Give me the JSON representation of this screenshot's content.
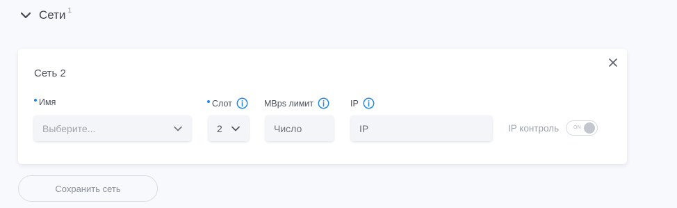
{
  "section": {
    "title": "Сети",
    "count": "1"
  },
  "card": {
    "title": "Сеть 2",
    "fields": {
      "name": {
        "label": "Имя",
        "placeholder": "Выберите..."
      },
      "slot": {
        "label": "Слот",
        "value": "2"
      },
      "mbps": {
        "label": "MBps лимит",
        "placeholder": "Число"
      },
      "ip": {
        "label": "IP",
        "placeholder": "IP"
      }
    },
    "ip_control": {
      "label": "IP контроль",
      "toggle_text": "ON"
    }
  },
  "actions": {
    "save_label": "Сохранить сеть"
  },
  "colors": {
    "accent": "#1e88e5",
    "background": "#f8f9fc",
    "card": "#ffffff"
  },
  "icons": [
    "chevron-down-icon",
    "close-icon",
    "info-icon",
    "chevron-down-icon"
  ]
}
